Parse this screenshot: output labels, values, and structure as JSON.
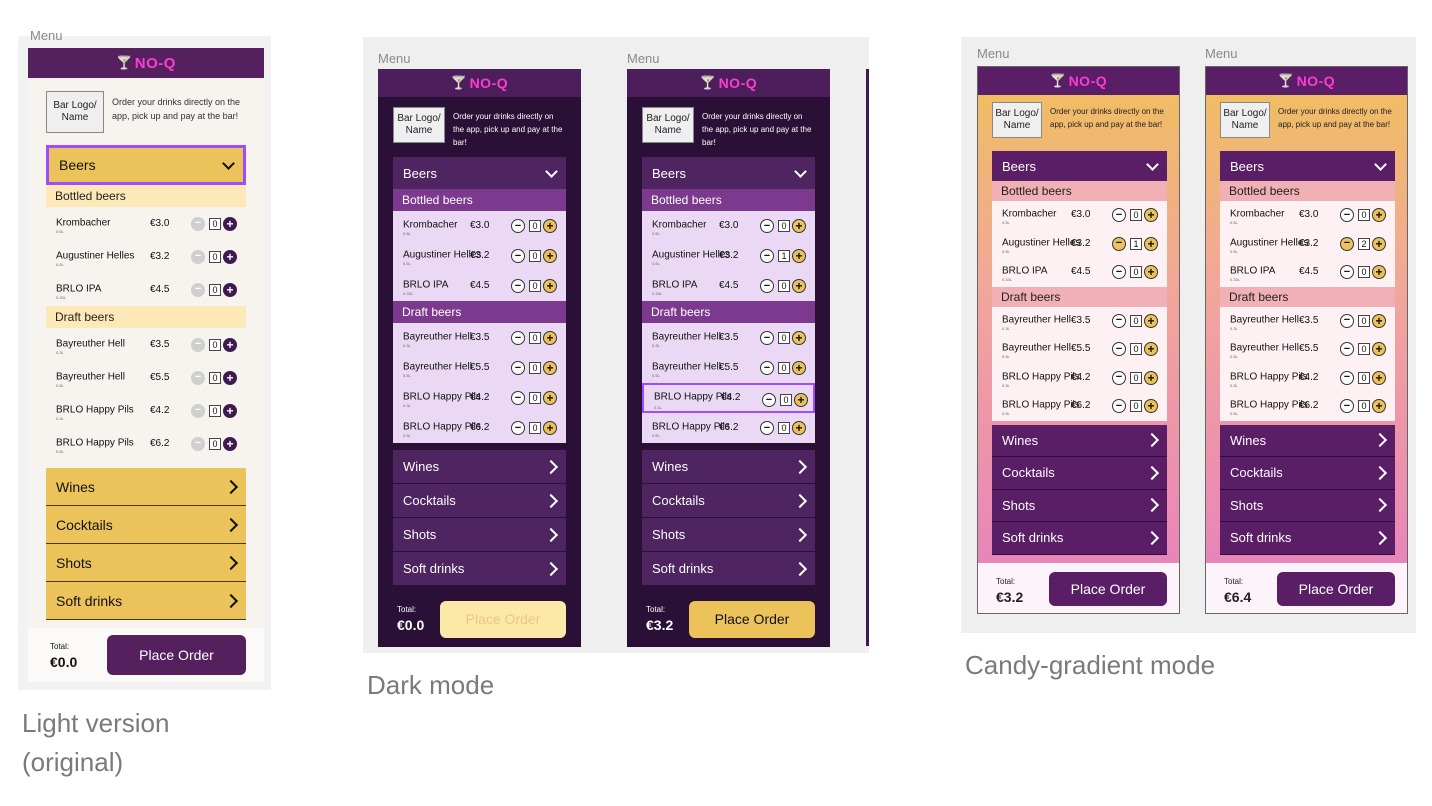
{
  "app": {
    "brand": "NO-Q",
    "frame_label": "Menu"
  },
  "header": {
    "logo_placeholder": "Bar Logo/ Name",
    "tagline": "Order your drinks directly on the app, pick up and pay at the bar!"
  },
  "categories": {
    "beers": "Beers",
    "wines": "Wines",
    "cocktails": "Cocktails",
    "shots": "Shots",
    "soft_drinks": "Soft drinks"
  },
  "sections": {
    "bottled": "Bottled beers",
    "draft": "Draft beers"
  },
  "items": [
    {
      "name": "Krombacher",
      "price": "€3.0",
      "size": "0.5L"
    },
    {
      "name": "Augustiner Helles",
      "price": "€3.2",
      "size": "0.5L"
    },
    {
      "name": "BRLO IPA",
      "price": "€4.5",
      "size": "0.33L"
    },
    {
      "name": "Bayreuther Hell",
      "price": "€3.5",
      "size": "0.3L"
    },
    {
      "name": "Bayreuther Hell",
      "price": "€5.5",
      "size": "0.5L"
    },
    {
      "name": "BRLO Happy Pils",
      "price": "€4.2",
      "size": "0.3L"
    },
    {
      "name": "BRLO Happy Pils",
      "price": "€6.2",
      "size": "0.5L"
    }
  ],
  "footer": {
    "total_label": "Total:",
    "place_order": "Place Order"
  },
  "variants": [
    {
      "caption": "Light version (original)",
      "total": "€0.0",
      "quantities": [
        "0",
        "0",
        "0",
        "0",
        "0",
        "0",
        "0"
      ]
    },
    {
      "caption": "Dark mode",
      "total": "€0.0",
      "quantities": [
        "0",
        "0",
        "0",
        "0",
        "0",
        "0",
        "0"
      ]
    },
    {
      "caption": "",
      "total": "€3.2",
      "quantities": [
        "0",
        "1",
        "0",
        "0",
        "0",
        "0",
        "0"
      ]
    },
    {
      "caption": "Candy-gradient mode",
      "total": "€3.2",
      "quantities": [
        "0",
        "1",
        "0",
        "0",
        "0",
        "0",
        "0"
      ]
    },
    {
      "caption": "",
      "total": "€6.4",
      "quantities": [
        "0",
        "2",
        "0",
        "0",
        "0",
        "0",
        "0"
      ]
    }
  ],
  "colors": {
    "purple_dark": "#3e1a4f",
    "purple_bar": "#55205e",
    "dark_bg": "#2a0f36",
    "dark_sub": "#7c3a8e",
    "dark_item_bg": "#ead8f5",
    "gold": "#ecc35b",
    "gold_light": "#fde9b8",
    "candy_item": "#fdf1f3",
    "candy_sub": "#f1b0b5",
    "light_bg": "#f7f3ef"
  },
  "captions": {
    "light": "Light version (original)",
    "dark": "Dark mode",
    "candy": "Candy-gradient mode"
  }
}
